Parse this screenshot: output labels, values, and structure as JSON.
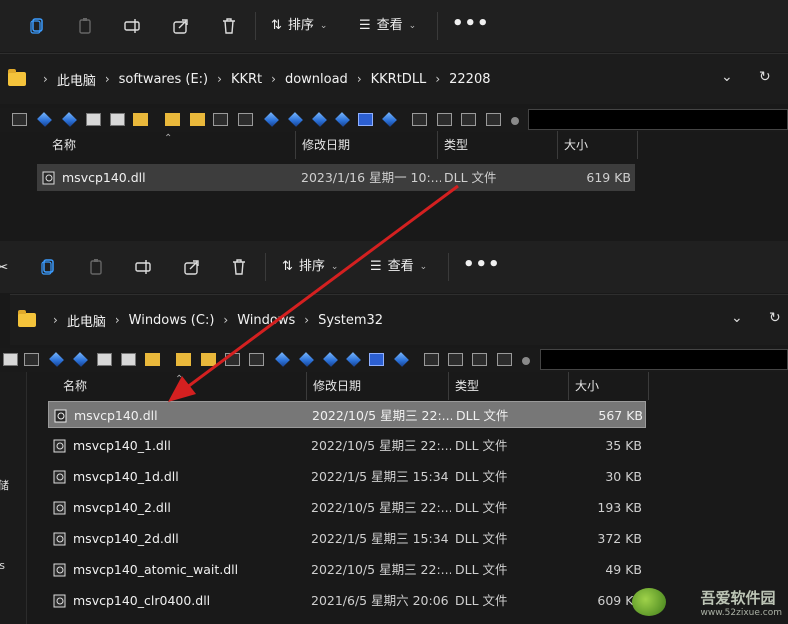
{
  "top_window": {
    "toolbar": {
      "sort_label": "排序",
      "view_label": "查看",
      "more_label": "•••"
    },
    "breadcrumb": [
      "此电脑",
      "softwares (E:)",
      "KKRt",
      "download",
      "KKRtDLL",
      "22208"
    ],
    "columns": {
      "name": "名称",
      "date": "修改日期",
      "type": "类型",
      "size": "大小"
    },
    "files": [
      {
        "name": "msvcp140.dll",
        "date": "2023/1/16 星期一 10:...",
        "type": "DLL 文件",
        "size": "619 KB"
      }
    ]
  },
  "bottom_window": {
    "toolbar": {
      "sort_label": "排序",
      "view_label": "查看",
      "more_label": "•••"
    },
    "breadcrumb": [
      "此电脑",
      "Windows (C:)",
      "Windows",
      "System32"
    ],
    "columns": {
      "name": "名称",
      "date": "修改日期",
      "type": "类型",
      "size": "大小"
    },
    "files": [
      {
        "name": "msvcp140.dll",
        "date": "2022/10/5 星期三 22:...",
        "type": "DLL 文件",
        "size": "567 KB"
      },
      {
        "name": "msvcp140_1.dll",
        "date": "2022/10/5 星期三 22:...",
        "type": "DLL 文件",
        "size": "35 KB"
      },
      {
        "name": "msvcp140_1d.dll",
        "date": "2022/1/5 星期三 15:34",
        "type": "DLL 文件",
        "size": "30 KB"
      },
      {
        "name": "msvcp140_2.dll",
        "date": "2022/10/5 星期三 22:...",
        "type": "DLL 文件",
        "size": "193 KB"
      },
      {
        "name": "msvcp140_2d.dll",
        "date": "2022/1/5 星期三 15:34",
        "type": "DLL 文件",
        "size": "372 KB"
      },
      {
        "name": "msvcp140_atomic_wait.dll",
        "date": "2022/10/5 星期三 22:...",
        "type": "DLL 文件",
        "size": "49 KB"
      },
      {
        "name": "msvcp140_clr0400.dll",
        "date": "2021/6/5 星期六 20:06",
        "type": "DLL 文件",
        "size": "609 KB"
      }
    ],
    "left_pane_fragments": [
      "储",
      "ers"
    ]
  },
  "watermark": {
    "text": "吾爱软件园",
    "url": "www.52zixue.com"
  },
  "colors": {
    "arrow": "#d42020",
    "background": "#191919",
    "toolbar": "#202020",
    "selected_row": "#777777"
  }
}
